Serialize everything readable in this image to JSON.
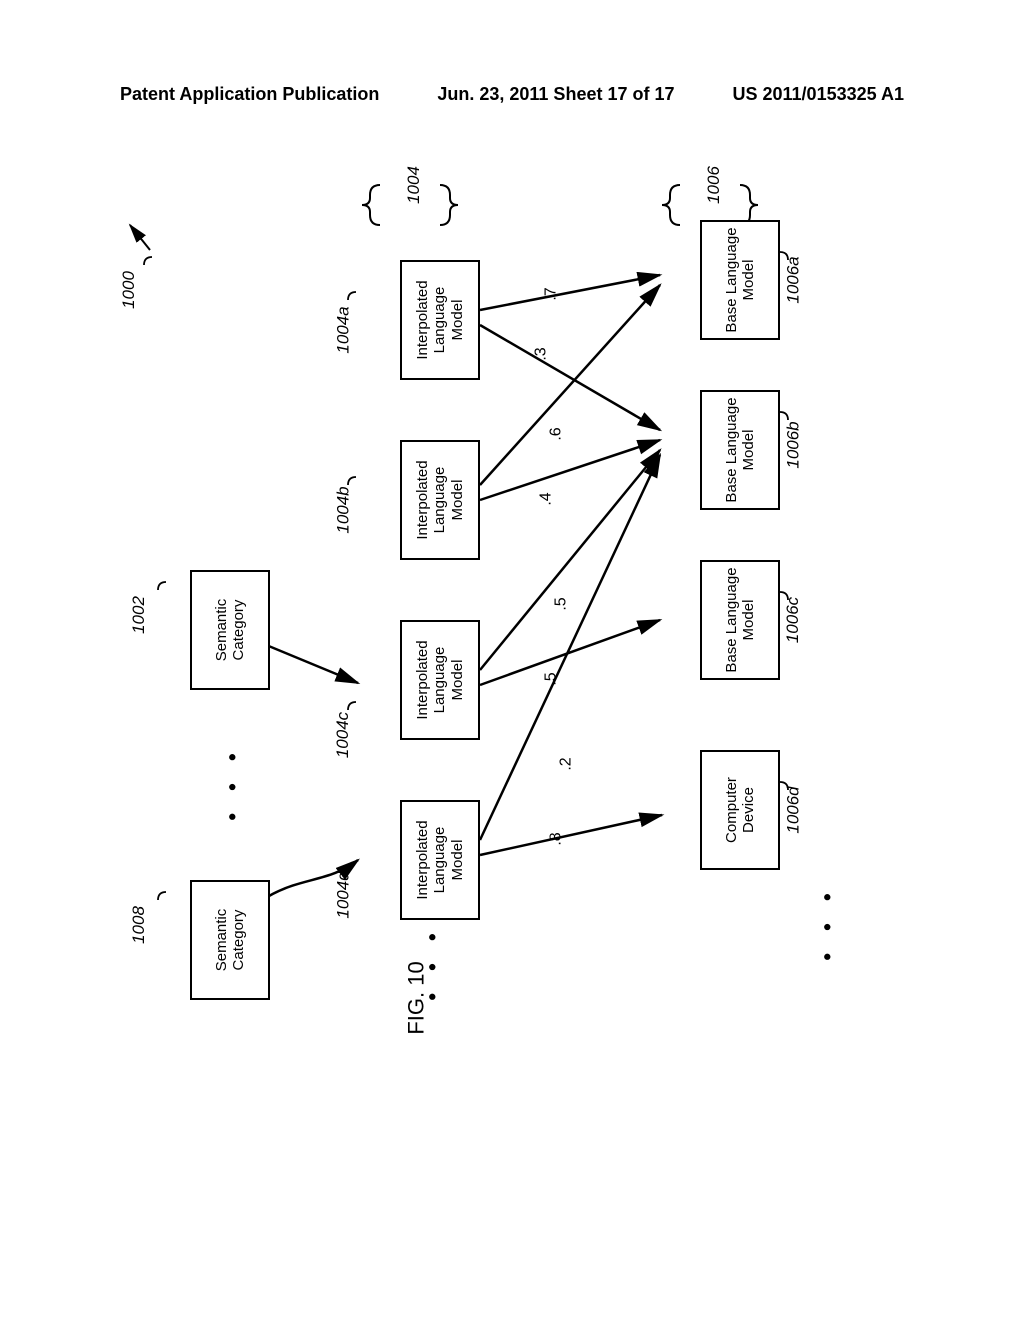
{
  "header": {
    "left": "Patent Application Publication",
    "center": "Jun. 23, 2011  Sheet 17 of 17",
    "right": "US 2011/0153325 A1"
  },
  "figure_label": "FIG. 10",
  "refs": {
    "main": "1000",
    "sem1": "1002",
    "sem2": "1008",
    "interp_group": "1004",
    "interp_a": "1004a",
    "interp_b": "1004b",
    "interp_c": "1004c",
    "interp_d": "1004d",
    "base_group": "1006",
    "base_a": "1006a",
    "base_b": "1006b",
    "base_c": "1006c",
    "base_d": "1006d"
  },
  "boxes": {
    "semantic": "Semantic\nCategory",
    "interpolated": "Interpolated\nLanguage\nModel",
    "base": "Base Language\nModel",
    "computer": "Computer\nDevice"
  },
  "weights": {
    "w1": ".7",
    "w2": ".3",
    "w3": ".6",
    "w4": ".4",
    "w5": ".5",
    "w6": ".5",
    "w7": ".2",
    "w8": ".8"
  }
}
